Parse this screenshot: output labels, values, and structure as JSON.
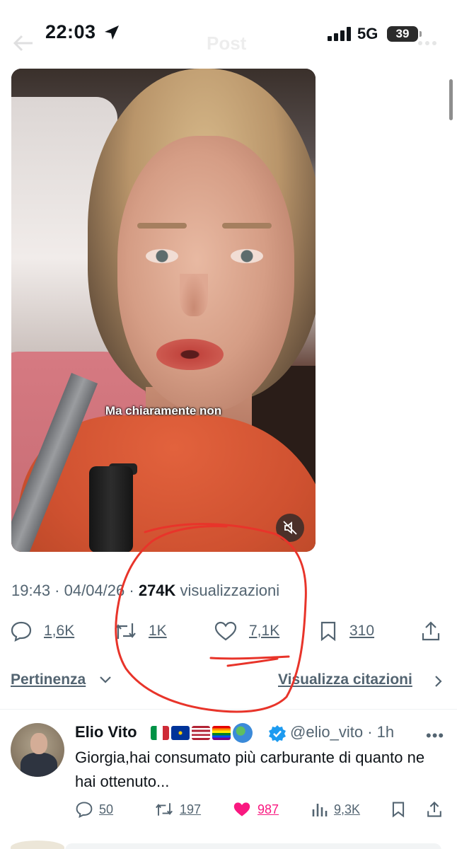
{
  "status_bar": {
    "time": "22:03",
    "network": "5G",
    "battery": "39"
  },
  "header": {
    "title": "Post"
  },
  "video": {
    "caption": "Ma chiaramente non"
  },
  "post": {
    "time": "19:43",
    "date": "04/04/26",
    "views_count": "274K",
    "views_label": "visualizzazioni"
  },
  "actions": {
    "replies": "1,6K",
    "reposts": "1K",
    "likes": "7,1K",
    "bookmarks": "310"
  },
  "sort": {
    "label": "Pertinenza",
    "quotes_link": "Visualizza citazioni"
  },
  "reply": {
    "name": "Elio Vito",
    "handle": "@elio_vito",
    "time": "· 1h",
    "text": "Giorgia,hai consumato più carburante di quanto ne hai ottenuto...",
    "stats": {
      "replies": "50",
      "reposts": "197",
      "likes": "987",
      "views": "9,3K"
    }
  },
  "colors": {
    "accent": "#1d9bf0",
    "like": "#f91880",
    "annotation": "#e8342a",
    "muted": "#536471"
  },
  "icons": [
    "location-arrow-icon",
    "signal-icon",
    "back-arrow-icon",
    "mute-icon",
    "reply-icon",
    "repost-icon",
    "like-icon",
    "bookmark-icon",
    "share-icon",
    "chevron-down-icon",
    "chevron-right-icon",
    "verified-badge-icon",
    "more-icon",
    "views-icon"
  ]
}
